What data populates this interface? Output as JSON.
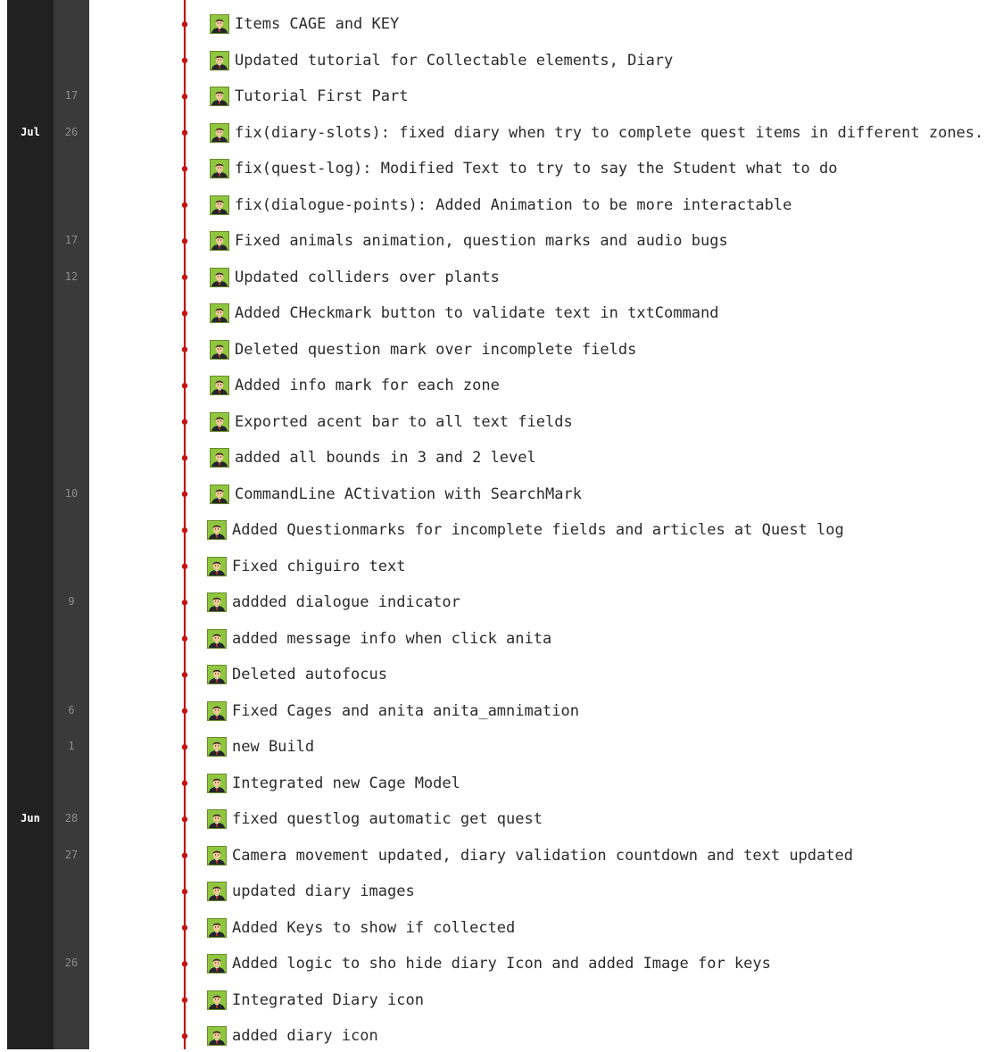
{
  "colors": {
    "graph_line": "#c41414",
    "commit_dot": "#c41414",
    "month_bg": "#212121",
    "day_bg": "#3a3a3a",
    "avatar_bg": "#8fc63f"
  },
  "months": [
    {
      "label": "Jul",
      "label_row": 3,
      "first_row": 0,
      "last_row": 13
    },
    {
      "label": "Jun",
      "label_row": 22,
      "first_row": 14,
      "last_row": 28
    }
  ],
  "commits": [
    {
      "day": "",
      "message": "Items CAGE and KEY"
    },
    {
      "day": "",
      "message": "Updated tutorial for Collectable elements, Diary"
    },
    {
      "day": "17",
      "message": "Tutorial First Part"
    },
    {
      "day": "26",
      "message": "fix(diary-slots): fixed diary when try to complete quest items in different zones."
    },
    {
      "day": "",
      "message": "fix(quest-log): Modified Text to try to say the Student what to do"
    },
    {
      "day": "",
      "message": "fix(dialogue-points): Added Animation to be more interactable"
    },
    {
      "day": "17",
      "message": "Fixed animals animation, question marks and audio bugs"
    },
    {
      "day": "12",
      "message": "Updated colliders over plants"
    },
    {
      "day": "",
      "message": "Added CHeckmark button to validate text in txtCommand"
    },
    {
      "day": "",
      "message": "Deleted question mark over incomplete fields"
    },
    {
      "day": "",
      "message": "Added info mark for each zone"
    },
    {
      "day": "",
      "message": "Exported acent bar to all text fields"
    },
    {
      "day": "",
      "message": "added all bounds in 3 and 2 level"
    },
    {
      "day": "10",
      "message": "CommandLine ACtivation with SearchMark"
    },
    {
      "day": "",
      "message": "Added Questionmarks for incomplete fields and articles at Quest log"
    },
    {
      "day": "",
      "message": "Fixed chiguiro text"
    },
    {
      "day": "9",
      "message": "addded dialogue indicator"
    },
    {
      "day": "",
      "message": "added message info when click anita"
    },
    {
      "day": "",
      "message": "Deleted autofocus"
    },
    {
      "day": "6",
      "message": "Fixed Cages and anita anita_amnimation"
    },
    {
      "day": "1",
      "message": "new Build"
    },
    {
      "day": "",
      "message": "Integrated new Cage Model"
    },
    {
      "day": "28",
      "message": "fixed questlog automatic get quest"
    },
    {
      "day": "27",
      "message": "Camera movement updated, diary validation countdown and text updated"
    },
    {
      "day": "",
      "message": "updated diary images"
    },
    {
      "day": "",
      "message": "Added Keys to show if collected"
    },
    {
      "day": "26",
      "message": "Added logic to sho hide diary Icon and added Image for keys"
    },
    {
      "day": "",
      "message": "Integrated Diary icon"
    },
    {
      "day": "",
      "message": "added diary icon"
    }
  ]
}
